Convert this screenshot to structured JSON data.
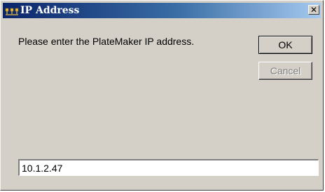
{
  "window": {
    "title": "IP Address",
    "icon": "network-computers-icon",
    "close_glyph": "✕"
  },
  "dialog": {
    "message": "Please enter the PlateMaker IP address.",
    "ok_label": "OK",
    "cancel_label": "Cancel",
    "cancel_enabled": false,
    "ip_value": "10.1.2.47"
  },
  "colors": {
    "titlebar_start": "#0a246a",
    "titlebar_end": "#a6caf0",
    "face": "#d4d0c8",
    "disabled_text": "#808080"
  }
}
